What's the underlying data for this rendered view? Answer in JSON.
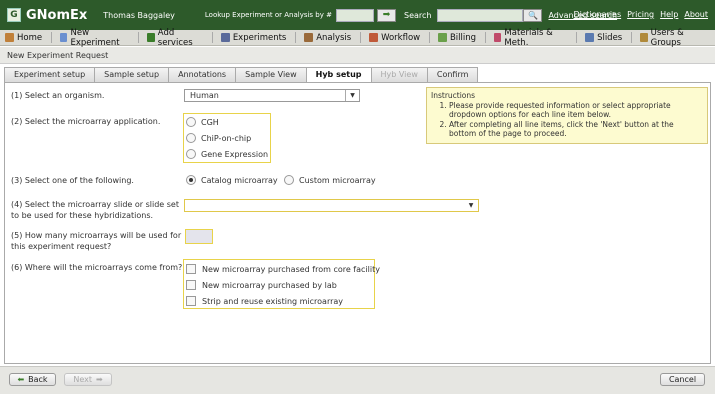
{
  "header": {
    "app_name": "GNomEx",
    "user_name": "Thomas Baggaley",
    "lookup_label": "Lookup Experiment or Analysis by #",
    "lookup_value": "",
    "search_label": "Search",
    "search_value": "",
    "advanced_search": "Advanced search",
    "links": [
      "Dictionaries",
      "Pricing",
      "Help",
      "About"
    ]
  },
  "nav": {
    "items": [
      {
        "label": "Home",
        "icon": "home-icon",
        "color": "#c0803a"
      },
      {
        "label": "New Experiment",
        "icon": "new-experiment-icon",
        "color": "#6a8fd0"
      },
      {
        "label": "Add services",
        "icon": "add-services-icon",
        "color": "#3a7d2a"
      },
      {
        "label": "Experiments",
        "icon": "experiments-icon",
        "color": "#5a6a9a"
      },
      {
        "label": "Analysis",
        "icon": "analysis-icon",
        "color": "#9a6a3a"
      },
      {
        "label": "Workflow",
        "icon": "workflow-icon",
        "color": "#c05a3a"
      },
      {
        "label": "Billing",
        "icon": "billing-icon",
        "color": "#6aa04a"
      },
      {
        "label": "Materials & Meth.",
        "icon": "materials-icon",
        "color": "#c04a6a"
      },
      {
        "label": "Slides",
        "icon": "slides-icon",
        "color": "#5a7ab0"
      },
      {
        "label": "Users & Groups",
        "icon": "users-groups-icon",
        "color": "#b08a3a"
      }
    ]
  },
  "window_title": "New Experiment Request",
  "tabs": [
    {
      "label": "Experiment setup",
      "state": "normal"
    },
    {
      "label": "Sample setup",
      "state": "normal"
    },
    {
      "label": "Annotations",
      "state": "normal"
    },
    {
      "label": "Sample View",
      "state": "normal"
    },
    {
      "label": "Hyb setup",
      "state": "active"
    },
    {
      "label": "Hyb View",
      "state": "disabled"
    },
    {
      "label": "Confirm",
      "state": "normal"
    }
  ],
  "form": {
    "q1": "(1) Select an organism.",
    "organism_value": "Human",
    "q2": "(2) Select the microarray application.",
    "applications": [
      "CGH",
      "ChiP-on-chip",
      "Gene Expression"
    ],
    "q3": "(3) Select one of the following.",
    "microarray_options": [
      "Catalog microarray",
      "Custom microarray"
    ],
    "microarray_selected": "Catalog microarray",
    "q4_line1": "(4) Select the microarray slide or slide set",
    "q4_line2": "to be used  for these hybridizations.",
    "slide_value": "",
    "q5_line1": "(5) How many microarrays will be used for",
    "q5_line2": "this experiment request?",
    "count_value": "",
    "q6": "(6) Where will the microarrays come from?",
    "sources": [
      "New microarray purchased from core facility",
      "New microarray purchased by lab",
      "Strip and reuse existing microarray"
    ]
  },
  "instructions": {
    "title": "Instructions",
    "items": [
      "Please provide requested information or select appropriate dropdown options for each line item below.",
      "After completing all line items, click the 'Next' button at the bottom of the page to proceed."
    ]
  },
  "footer": {
    "back_label": "Back",
    "next_label": "Next",
    "cancel_label": "Cancel"
  }
}
